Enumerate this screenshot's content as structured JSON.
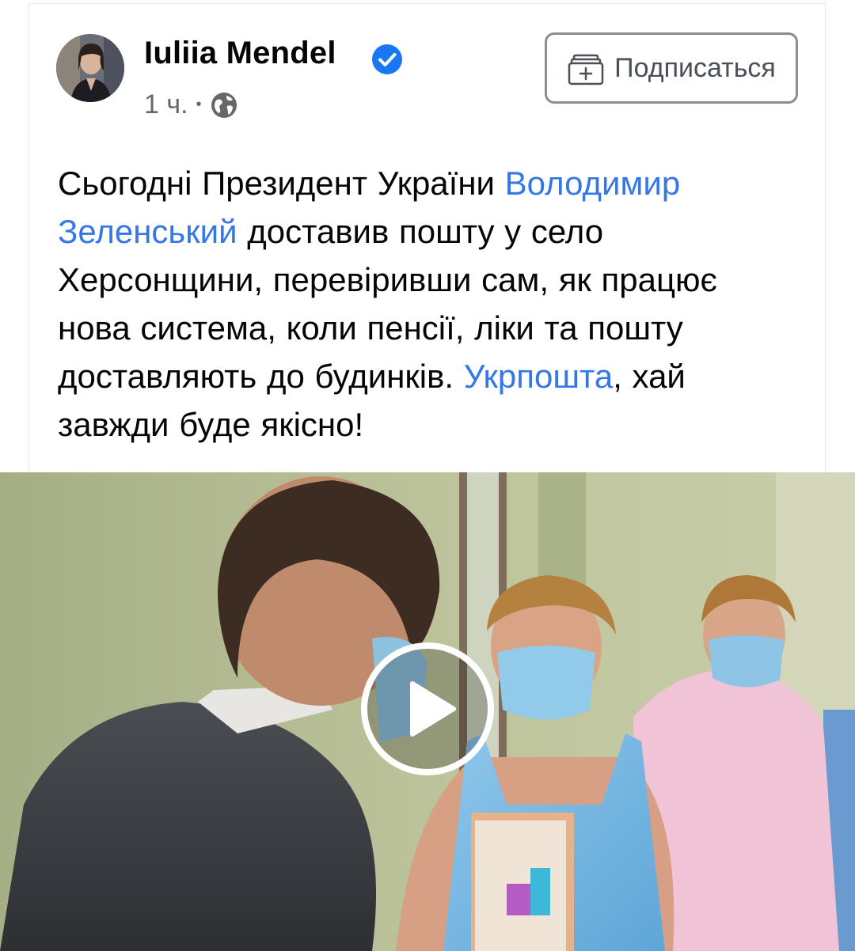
{
  "post": {
    "author": "Iuliia Mendel",
    "timestamp": "1 ч.",
    "separator": "•",
    "follow_label": "Подписаться",
    "text_parts": [
      {
        "text": "Сьогодні Президент України ",
        "link": false
      },
      {
        "text": "Володимир Зеленський",
        "link": true
      },
      {
        "text": " доставив пошту у село Херсонщини, перевіривши сам, як працює нова система, коли пенсії, ліки та пошту доставляють до будинків. ",
        "link": false
      },
      {
        "text": "Укрпошта",
        "link": true
      },
      {
        "text": ", хай завжди буде якісно!",
        "link": false
      }
    ]
  },
  "icons": {
    "verified": "verified-badge-icon",
    "privacy": "globe-icon",
    "follow": "add-feed-icon",
    "play": "play-icon"
  },
  "colors": {
    "link": "#3578e5",
    "verified": "#1877f2",
    "text": "#050505",
    "muted": "#65676b"
  }
}
